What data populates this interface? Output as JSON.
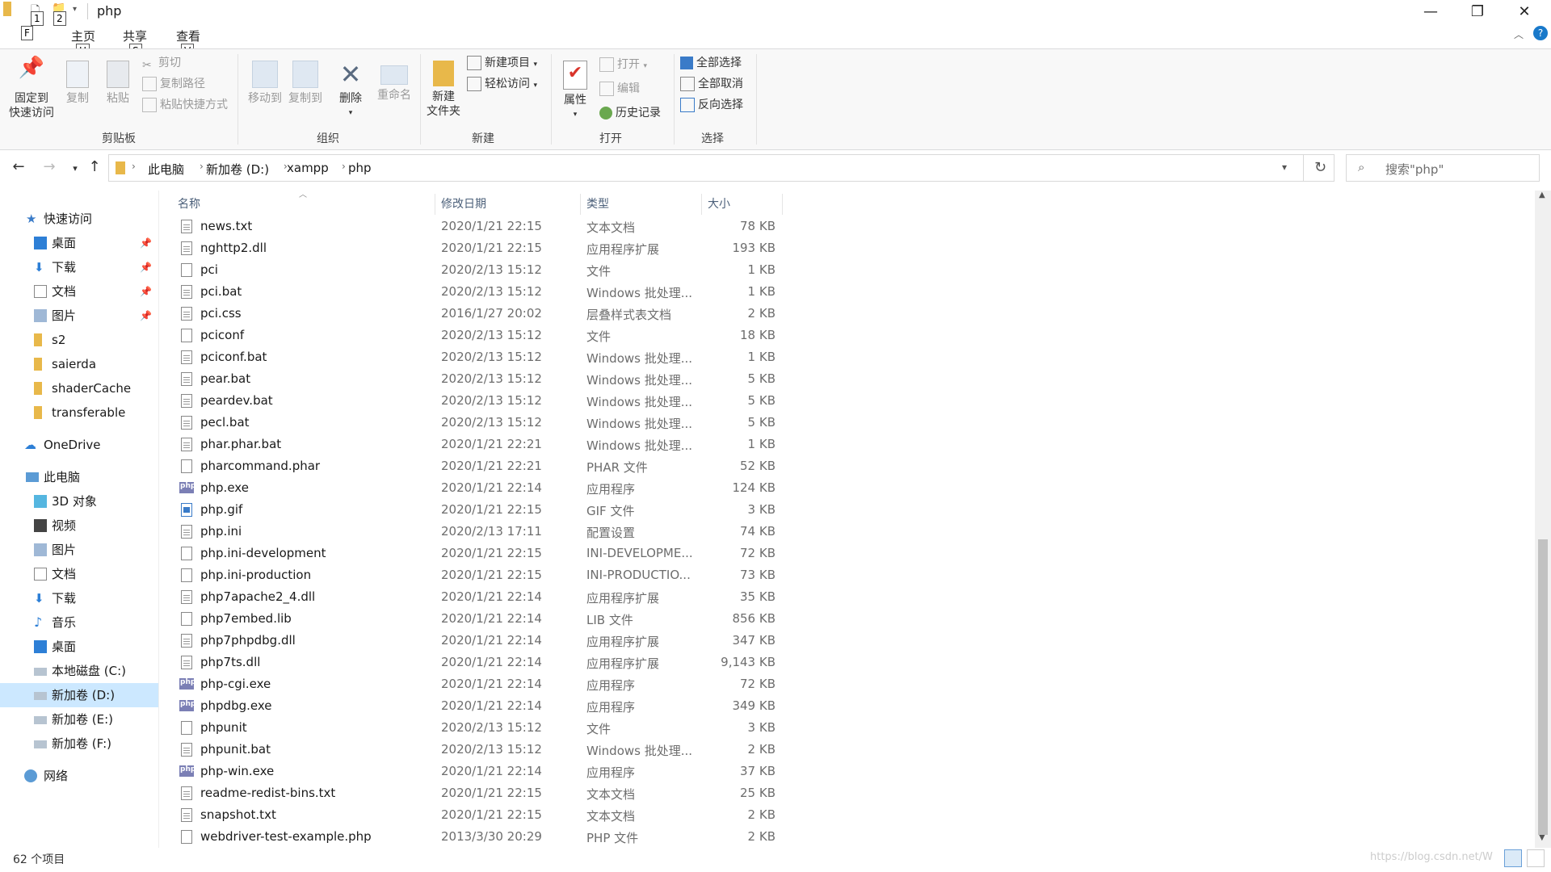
{
  "window": {
    "title": "php"
  },
  "titlebar": {
    "minimize": "—",
    "maximize": "❐",
    "close": "✕",
    "keytips": [
      "1",
      "2",
      "F",
      "H",
      "S",
      "V"
    ]
  },
  "tabs": {
    "file": "文件",
    "home": "主页",
    "share": "共享",
    "view": "查看"
  },
  "ribbon": {
    "clipboard": {
      "pin": [
        "固定到",
        "快速访问"
      ],
      "copy": "复制",
      "paste": "粘贴",
      "cut": "剪切",
      "copy_path": "复制路径",
      "paste_shortcut": "粘贴快捷方式",
      "group": "剪贴板"
    },
    "organize": {
      "move_to": "移动到",
      "copy_to": "复制到",
      "delete": "删除",
      "rename": "重命名",
      "group": "组织"
    },
    "new": {
      "new_folder": [
        "新建",
        "文件夹"
      ],
      "new_item": "新建项目",
      "easy_access": "轻松访问",
      "group": "新建"
    },
    "open": {
      "properties": "属性",
      "open": "打开",
      "edit": "编辑",
      "history": "历史记录",
      "group": "打开"
    },
    "select": {
      "select_all": "全部选择",
      "select_none": "全部取消",
      "invert": "反向选择",
      "group": "选择"
    }
  },
  "nav": {
    "breadcrumb": [
      "此电脑",
      "新加卷 (D:)",
      "xampp",
      "php"
    ],
    "search_placeholder": "搜索\"php\""
  },
  "sidebar": {
    "quick_access": "快速访问",
    "quick_items": [
      {
        "label": "桌面",
        "pinned": true
      },
      {
        "label": "下载",
        "pinned": true
      },
      {
        "label": "文档",
        "pinned": true
      },
      {
        "label": "图片",
        "pinned": true
      },
      {
        "label": "s2",
        "pinned": false
      },
      {
        "label": "saierda",
        "pinned": false
      },
      {
        "label": "shaderCache",
        "pinned": false
      },
      {
        "label": "transferable",
        "pinned": false
      }
    ],
    "onedrive": "OneDrive",
    "this_pc": "此电脑",
    "pc_items": [
      "3D 对象",
      "视频",
      "图片",
      "文档",
      "下载",
      "音乐",
      "桌面",
      "本地磁盘 (C:)",
      "新加卷 (D:)",
      "新加卷 (E:)",
      "新加卷 (F:)"
    ],
    "network": "网络"
  },
  "columns": {
    "name": "名称",
    "date": "修改日期",
    "type": "类型",
    "size": "大小"
  },
  "files": [
    {
      "name": "news.txt",
      "date": "2020/1/21 22:15",
      "type": "文本文档",
      "size": "78 KB",
      "icon": "txt"
    },
    {
      "name": "nghttp2.dll",
      "date": "2020/1/21 22:15",
      "type": "应用程序扩展",
      "size": "193 KB",
      "icon": "dll"
    },
    {
      "name": "pci",
      "date": "2020/2/13 15:12",
      "type": "文件",
      "size": "1 KB",
      "icon": "file"
    },
    {
      "name": "pci.bat",
      "date": "2020/2/13 15:12",
      "type": "Windows 批处理...",
      "size": "1 KB",
      "icon": "bat"
    },
    {
      "name": "pci.css",
      "date": "2016/1/27 20:02",
      "type": "层叠样式表文档",
      "size": "2 KB",
      "icon": "css"
    },
    {
      "name": "pciconf",
      "date": "2020/2/13 15:12",
      "type": "文件",
      "size": "18 KB",
      "icon": "file"
    },
    {
      "name": "pciconf.bat",
      "date": "2020/2/13 15:12",
      "type": "Windows 批处理...",
      "size": "1 KB",
      "icon": "bat"
    },
    {
      "name": "pear.bat",
      "date": "2020/2/13 15:12",
      "type": "Windows 批处理...",
      "size": "5 KB",
      "icon": "bat"
    },
    {
      "name": "peardev.bat",
      "date": "2020/2/13 15:12",
      "type": "Windows 批处理...",
      "size": "5 KB",
      "icon": "bat"
    },
    {
      "name": "pecl.bat",
      "date": "2020/2/13 15:12",
      "type": "Windows 批处理...",
      "size": "5 KB",
      "icon": "bat"
    },
    {
      "name": "phar.phar.bat",
      "date": "2020/1/21 22:21",
      "type": "Windows 批处理...",
      "size": "1 KB",
      "icon": "bat"
    },
    {
      "name": "pharcommand.phar",
      "date": "2020/1/21 22:21",
      "type": "PHAR 文件",
      "size": "52 KB",
      "icon": "file"
    },
    {
      "name": "php.exe",
      "date": "2020/1/21 22:14",
      "type": "应用程序",
      "size": "124 KB",
      "icon": "php"
    },
    {
      "name": "php.gif",
      "date": "2020/1/21 22:15",
      "type": "GIF 文件",
      "size": "3 KB",
      "icon": "gif"
    },
    {
      "name": "php.ini",
      "date": "2020/2/13 17:11",
      "type": "配置设置",
      "size": "74 KB",
      "icon": "ini"
    },
    {
      "name": "php.ini-development",
      "date": "2020/1/21 22:15",
      "type": "INI-DEVELOPME...",
      "size": "72 KB",
      "icon": "file"
    },
    {
      "name": "php.ini-production",
      "date": "2020/1/21 22:15",
      "type": "INI-PRODUCTIO...",
      "size": "73 KB",
      "icon": "file"
    },
    {
      "name": "php7apache2_4.dll",
      "date": "2020/1/21 22:14",
      "type": "应用程序扩展",
      "size": "35 KB",
      "icon": "dll"
    },
    {
      "name": "php7embed.lib",
      "date": "2020/1/21 22:14",
      "type": "LIB 文件",
      "size": "856 KB",
      "icon": "file"
    },
    {
      "name": "php7phpdbg.dll",
      "date": "2020/1/21 22:14",
      "type": "应用程序扩展",
      "size": "347 KB",
      "icon": "dll"
    },
    {
      "name": "php7ts.dll",
      "date": "2020/1/21 22:14",
      "type": "应用程序扩展",
      "size": "9,143 KB",
      "icon": "dll"
    },
    {
      "name": "php-cgi.exe",
      "date": "2020/1/21 22:14",
      "type": "应用程序",
      "size": "72 KB",
      "icon": "php"
    },
    {
      "name": "phpdbg.exe",
      "date": "2020/1/21 22:14",
      "type": "应用程序",
      "size": "349 KB",
      "icon": "php"
    },
    {
      "name": "phpunit",
      "date": "2020/2/13 15:12",
      "type": "文件",
      "size": "3 KB",
      "icon": "file"
    },
    {
      "name": "phpunit.bat",
      "date": "2020/2/13 15:12",
      "type": "Windows 批处理...",
      "size": "2 KB",
      "icon": "bat"
    },
    {
      "name": "php-win.exe",
      "date": "2020/1/21 22:14",
      "type": "应用程序",
      "size": "37 KB",
      "icon": "php"
    },
    {
      "name": "readme-redist-bins.txt",
      "date": "2020/1/21 22:15",
      "type": "文本文档",
      "size": "25 KB",
      "icon": "txt"
    },
    {
      "name": "snapshot.txt",
      "date": "2020/1/21 22:15",
      "type": "文本文档",
      "size": "2 KB",
      "icon": "txt"
    },
    {
      "name": "webdriver-test-example.php",
      "date": "2013/3/30 20:29",
      "type": "PHP 文件",
      "size": "2 KB",
      "icon": "file"
    }
  ],
  "status": {
    "count": "62 个项目",
    "watermark": "https://blog.csdn.net/W"
  },
  "colors": {
    "accent": "#1979ca",
    "folder": "#e8b84a",
    "selected": "#cce8ff",
    "column_header": "#4c607a"
  }
}
